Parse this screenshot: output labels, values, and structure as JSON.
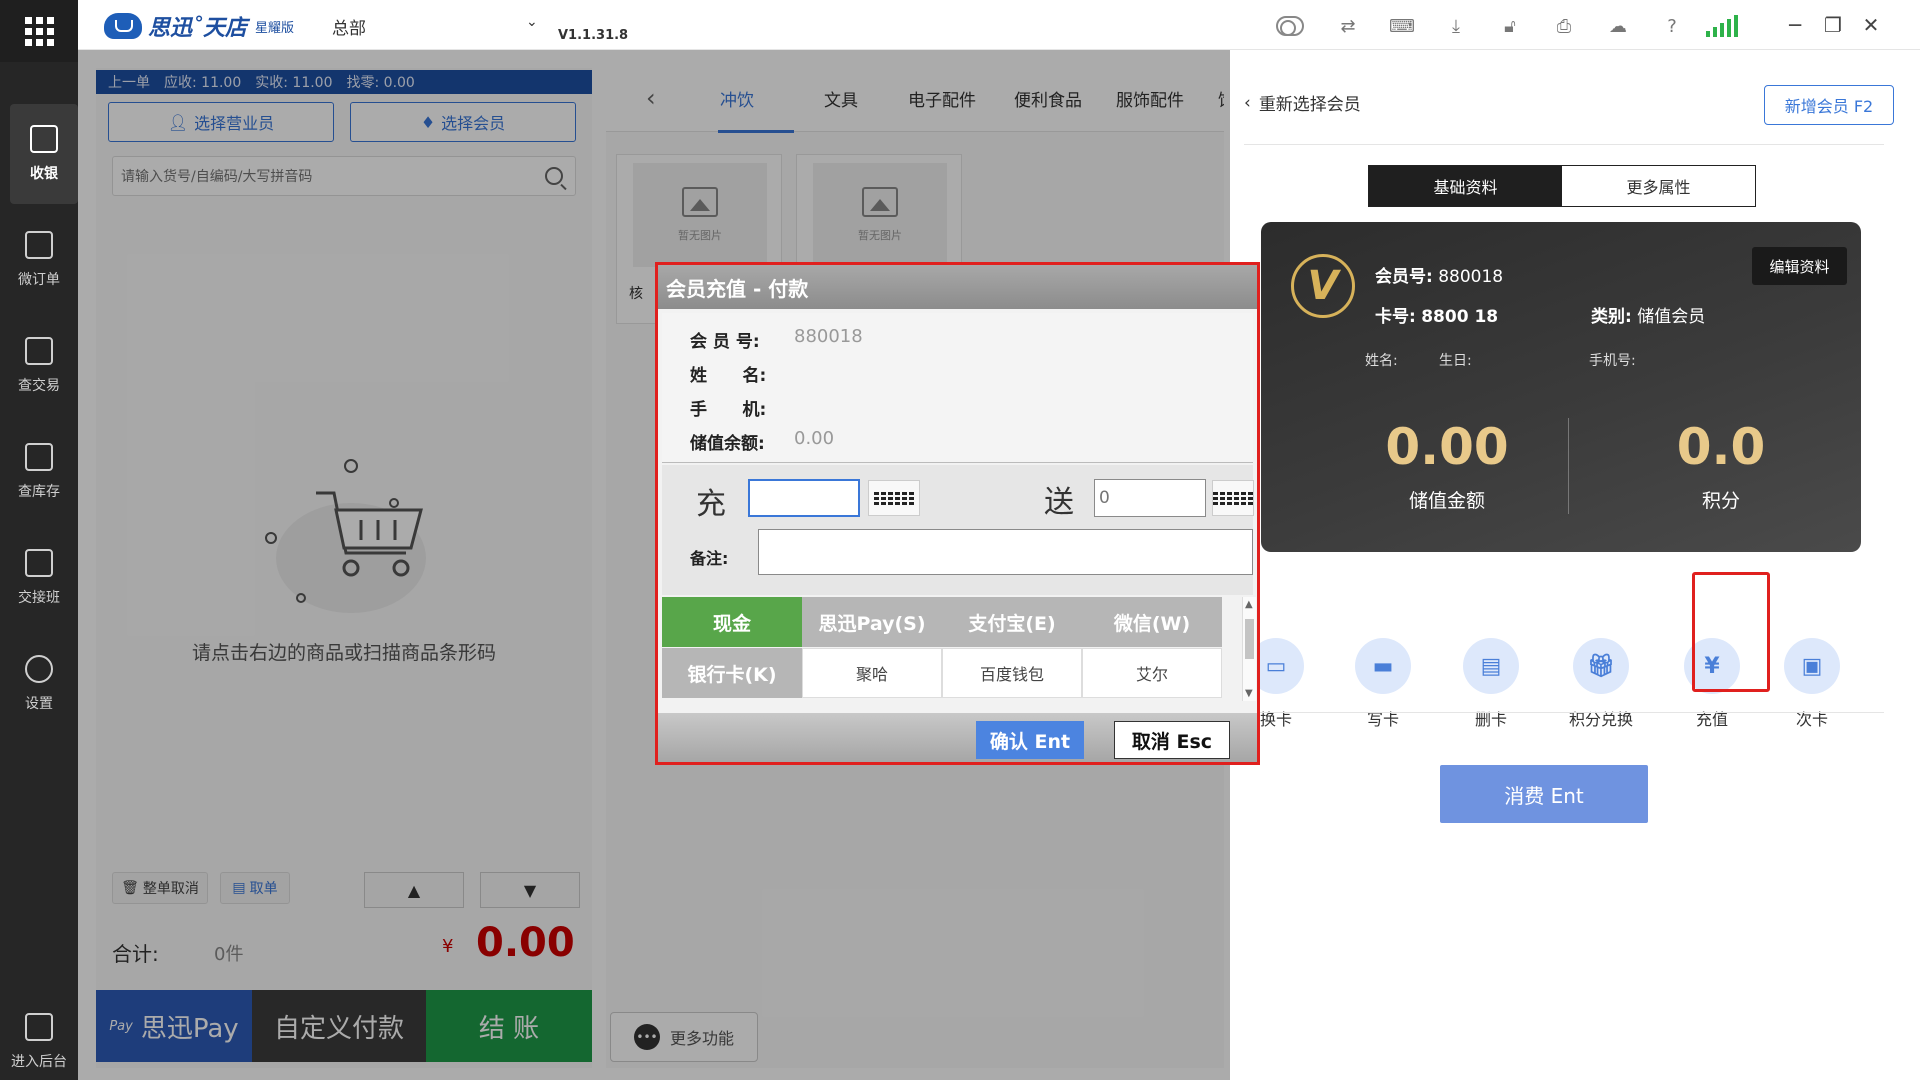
{
  "titlebar": {
    "brand_name": "思迅˚天店",
    "brand_edition": "星耀版",
    "store_name": "总部",
    "version": "V1.1.31.8",
    "icons": [
      "toggle-icon",
      "sync-icon",
      "keyboard-icon",
      "download-icon",
      "lock-icon",
      "printer-icon",
      "cloud-icon",
      "help-icon",
      "signal-icon"
    ],
    "window_controls": [
      "minimize",
      "restore",
      "close"
    ]
  },
  "nav": {
    "items": [
      {
        "label": "收银",
        "icon": "cashier-icon",
        "active": true
      },
      {
        "label": "微订单",
        "icon": "micro-order-icon"
      },
      {
        "label": "查交易",
        "icon": "transaction-icon"
      },
      {
        "label": "查库存",
        "icon": "inventory-icon"
      },
      {
        "label": "交接班",
        "icon": "shift-icon"
      },
      {
        "label": "设置",
        "icon": "settings-icon"
      }
    ],
    "bottom_label": "进入后台"
  },
  "cart": {
    "summary": {
      "prev": "上一单",
      "receivable": "应收:  11.00",
      "received": "实收:  11.00",
      "change": "找零:  0.00"
    },
    "select_clerk": "选择营业员",
    "select_member": "选择会员",
    "search_placeholder": "请输入货号/自编码/大写拼音码",
    "empty_text": "请点击右边的商品或扫描商品条形码",
    "cancel_all": "整单取消",
    "take_order": "取单",
    "total_label": "合计:",
    "total_count": "0件",
    "total_yen": "¥",
    "total_amount": "0.00",
    "pay_sixun": "思迅Pay",
    "pay_sixun_badge": "Pay",
    "pay_custom": "自定义付款",
    "pay_checkout": "结 账"
  },
  "goods": {
    "categories": [
      "冲饮",
      "文具",
      "电子配件",
      "便利食品",
      "服饰配件",
      "饮"
    ],
    "active_category": 0,
    "no_image_text": "暂无图片",
    "card_names": [
      "核",
      ""
    ],
    "more_label": "更多功能"
  },
  "member": {
    "back_label": "重新选择会员",
    "new_member": "新增会员 F2",
    "tabs": [
      "基础资料",
      "更多属性"
    ],
    "card": {
      "member_no_label": "会员号:",
      "member_no": "880018",
      "card_no_label": "卡号:",
      "card_no": "8800 18",
      "type_label": "类别:",
      "type_value": "储值会员",
      "name_label": "姓名:",
      "birthday_label": "生日:",
      "phone_label": "手机号:",
      "edit_label": "编辑资料",
      "balance": "0.00",
      "balance_label": "储值金额",
      "points": "0.0",
      "points_label": "积分"
    },
    "actions": [
      {
        "label": "换卡",
        "icon": "change-card-icon"
      },
      {
        "label": "写卡",
        "icon": "write-card-icon"
      },
      {
        "label": "删卡",
        "icon": "delete-card-icon"
      },
      {
        "label": "积分兑换",
        "icon": "gift-icon"
      },
      {
        "label": "充值",
        "icon": "recharge-icon"
      },
      {
        "label": "次卡",
        "icon": "ticket-icon"
      }
    ],
    "consume": "消费 Ent"
  },
  "dialog": {
    "title": "会员充值 - 付款",
    "member_no_label": "会 员 号:",
    "member_no": "880018",
    "name_label": "姓      名:",
    "phone_label": "手      机:",
    "balance_label": "储值余额:",
    "balance": "0.00",
    "recharge_char": "充",
    "gift_char": "送",
    "gift_placeholder": "0",
    "remark_label": "备注:",
    "payment_methods": [
      "现金",
      "思迅Pay(S)",
      "支付宝(E)",
      "微信(W)",
      "银行卡(K)",
      "聚哈",
      "百度钱包",
      "艾尔"
    ],
    "confirm": "确认 Ent",
    "cancel": "取消 Esc"
  },
  "colors": {
    "accent": "#3a77d8",
    "highlight": "#e0201e",
    "cash_selected": "#58a64a",
    "checkout": "#1e9a48",
    "amount_red": "#cc0000",
    "card_gold": "#e8c98a"
  }
}
